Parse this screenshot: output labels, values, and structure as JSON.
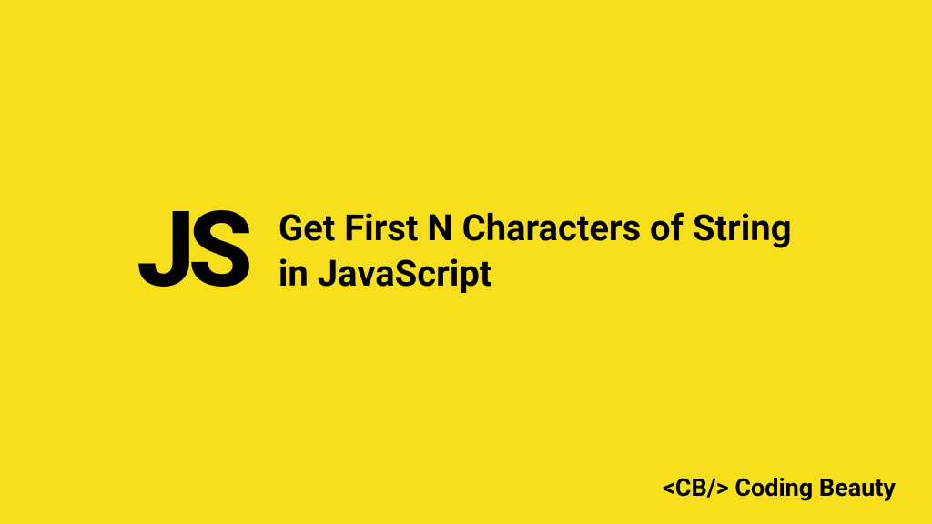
{
  "logo": "JS",
  "title": "Get First N Characters of String in JavaScript",
  "footer": "<CB/> Coding Beauty"
}
